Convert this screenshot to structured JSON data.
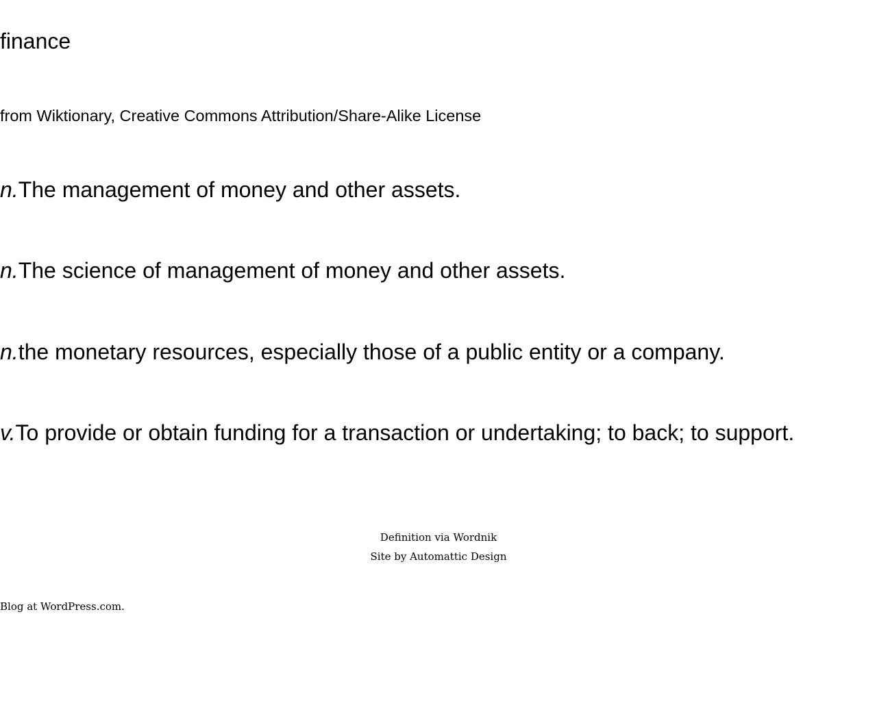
{
  "entry": {
    "word": "finance",
    "source": "from Wiktionary, Creative Commons Attribution/Share-Alike License",
    "definitions": [
      {
        "pos": "n.",
        "text": "The management of money and other assets."
      },
      {
        "pos": "n.",
        "text": "The science of management of money and other assets."
      },
      {
        "pos": "n.",
        "text": "the monetary resources, especially those of a public entity or a company."
      },
      {
        "pos": "v.",
        "text": "To provide or obtain funding for a transaction or undertaking; to back; to support."
      }
    ]
  },
  "credits": {
    "definition_prefix": "Definition via ",
    "definition_link": "Wordnik",
    "site_prefix": "Site by ",
    "site_link": "Automattic Design"
  },
  "footer": {
    "blog_link": "Blog at WordPress.com."
  }
}
